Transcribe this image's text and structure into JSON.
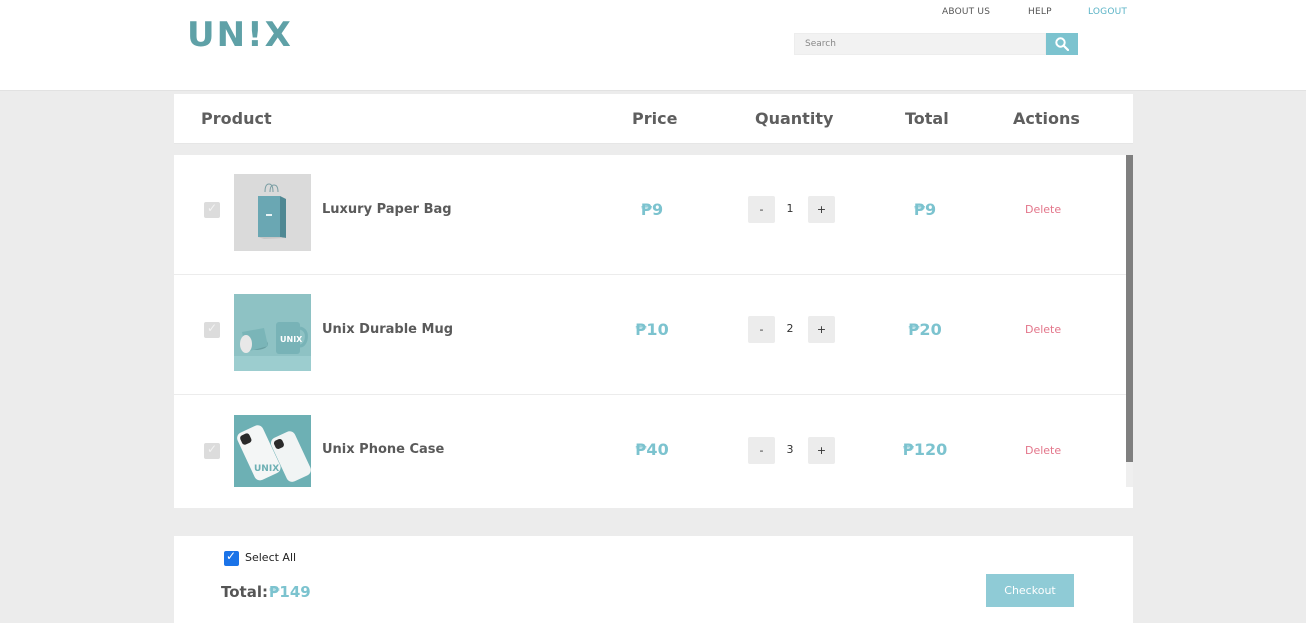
{
  "header": {
    "logo_text": "UN!X",
    "nav": {
      "about": "ABOUT US",
      "help": "HELP",
      "logout": "LOGOUT"
    },
    "search": {
      "placeholder": "Search",
      "value": ""
    }
  },
  "table": {
    "columns": {
      "product": "Product",
      "price": "Price",
      "quantity": "Quantity",
      "total": "Total",
      "actions": "Actions"
    },
    "rows": [
      {
        "name": "Luxury Paper Bag",
        "price": "₱9",
        "qty": "1",
        "total": "₱9",
        "action": "Delete",
        "image": "paper-bag-image",
        "checked": true
      },
      {
        "name": "Unix Durable Mug",
        "price": "₱10",
        "qty": "2",
        "total": "₱20",
        "action": "Delete",
        "image": "mug-image",
        "checked": true
      },
      {
        "name": "Unix Phone Case",
        "price": "₱40",
        "qty": "3",
        "total": "₱120",
        "action": "Delete",
        "image": "phone-case-image",
        "checked": true
      }
    ],
    "qty_minus": "-",
    "qty_plus": "+"
  },
  "footer": {
    "select_all_label": "Select All",
    "select_all_checked": true,
    "total_label": "Total:",
    "total_value": "₱149",
    "checkout_label": "Checkout"
  },
  "colors": {
    "accent": "#7cc3cf",
    "brand": "#5fa1a7",
    "delete": "#e3758a",
    "logout": "#5ab3c6"
  }
}
